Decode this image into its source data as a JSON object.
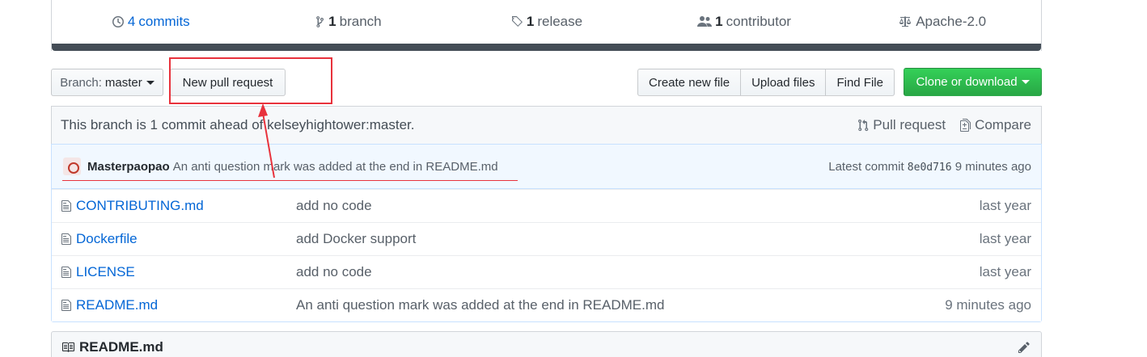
{
  "summary": {
    "commits": {
      "count": "4",
      "label": "commits",
      "icon": "history-icon"
    },
    "branch": {
      "count": "1",
      "label": "branch",
      "icon": "git-branch-icon"
    },
    "release": {
      "count": "1",
      "label": "release",
      "icon": "tag-icon"
    },
    "contributor": {
      "count": "1",
      "label": "contributor",
      "icon": "people-icon"
    },
    "license": {
      "label": "Apache-2.0",
      "icon": "law-icon"
    }
  },
  "toolbar": {
    "branch_prefix": "Branch:",
    "branch_name": "master",
    "new_pr": "New pull request",
    "create_file": "Create new file",
    "upload_files": "Upload files",
    "find_file": "Find File",
    "clone": "Clone or download"
  },
  "ahead": {
    "message": "This branch is 1 commit ahead of kelseyhightower:master.",
    "pull_request": "Pull request",
    "compare": "Compare"
  },
  "latest_commit": {
    "author": "Masterpaopao",
    "message": "An anti question mark was added at the end in README.md",
    "prefix": "Latest commit",
    "sha": "8e0d716",
    "age": "9 minutes ago"
  },
  "files": [
    {
      "name": "CONTRIBUTING.md",
      "message": "add no code",
      "age": "last year"
    },
    {
      "name": "Dockerfile",
      "message": "add Docker support",
      "age": "last year"
    },
    {
      "name": "LICENSE",
      "message": "add no code",
      "age": "last year"
    },
    {
      "name": "README.md",
      "message": "An anti question mark was added at the end in README.md",
      "age": "9 minutes ago"
    }
  ],
  "readme": {
    "title": "README.md"
  },
  "colors": {
    "accent": "#0366d6",
    "annotation": "#e8323c",
    "clone_green": "#28a745"
  }
}
